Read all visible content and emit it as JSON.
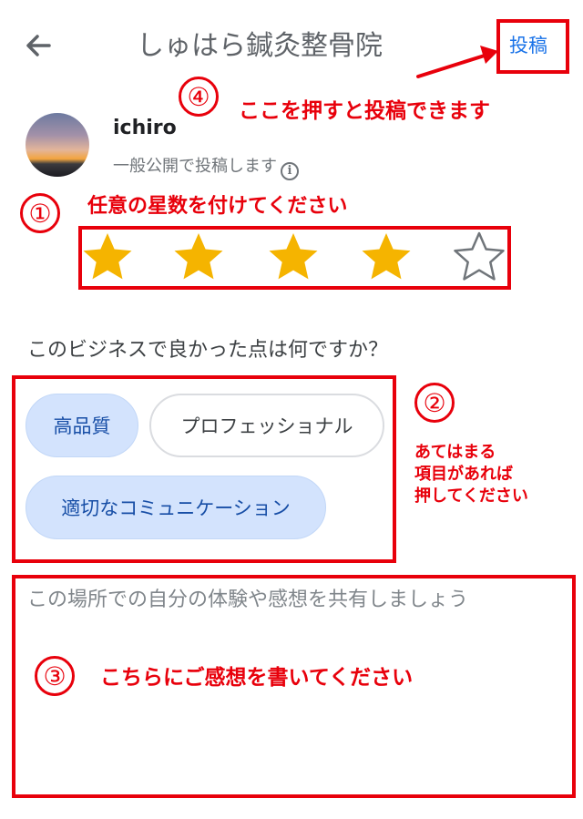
{
  "header": {
    "title": "しゅはら鍼灸整骨院",
    "post_label": "投稿"
  },
  "annotations": {
    "step4_num": "④",
    "step4_text": "ここを押すと投稿できます",
    "step1_num": "①",
    "step1_text": "任意の星数を付けてください",
    "step2_num": "②",
    "step2_text": [
      "あてはまる",
      "項目があれば",
      "押してください"
    ],
    "step3_num": "③",
    "step3_text": "こちらにご感想を書いてください",
    "color": "#e8000b"
  },
  "profile": {
    "name": "ichiro",
    "visibility": "一般公開で投稿します",
    "info_icon": "i"
  },
  "rating": {
    "max": 5,
    "value": 4,
    "filled_color": "#f5b400",
    "empty_color": "#70757a"
  },
  "question": "このビジネスで良かった点は何ですか？",
  "chips": [
    {
      "label": "高品質",
      "selected": true
    },
    {
      "label": "プロフェッショナル",
      "selected": false
    },
    {
      "label": "適切なコミュニケーション",
      "selected": true
    }
  ],
  "review": {
    "placeholder": "この場所での自分の体験や感想を共有しましょう",
    "value": ""
  },
  "colors": {
    "accent": "#1a73e8",
    "chip_selected_bg": "#d3e3fd"
  }
}
